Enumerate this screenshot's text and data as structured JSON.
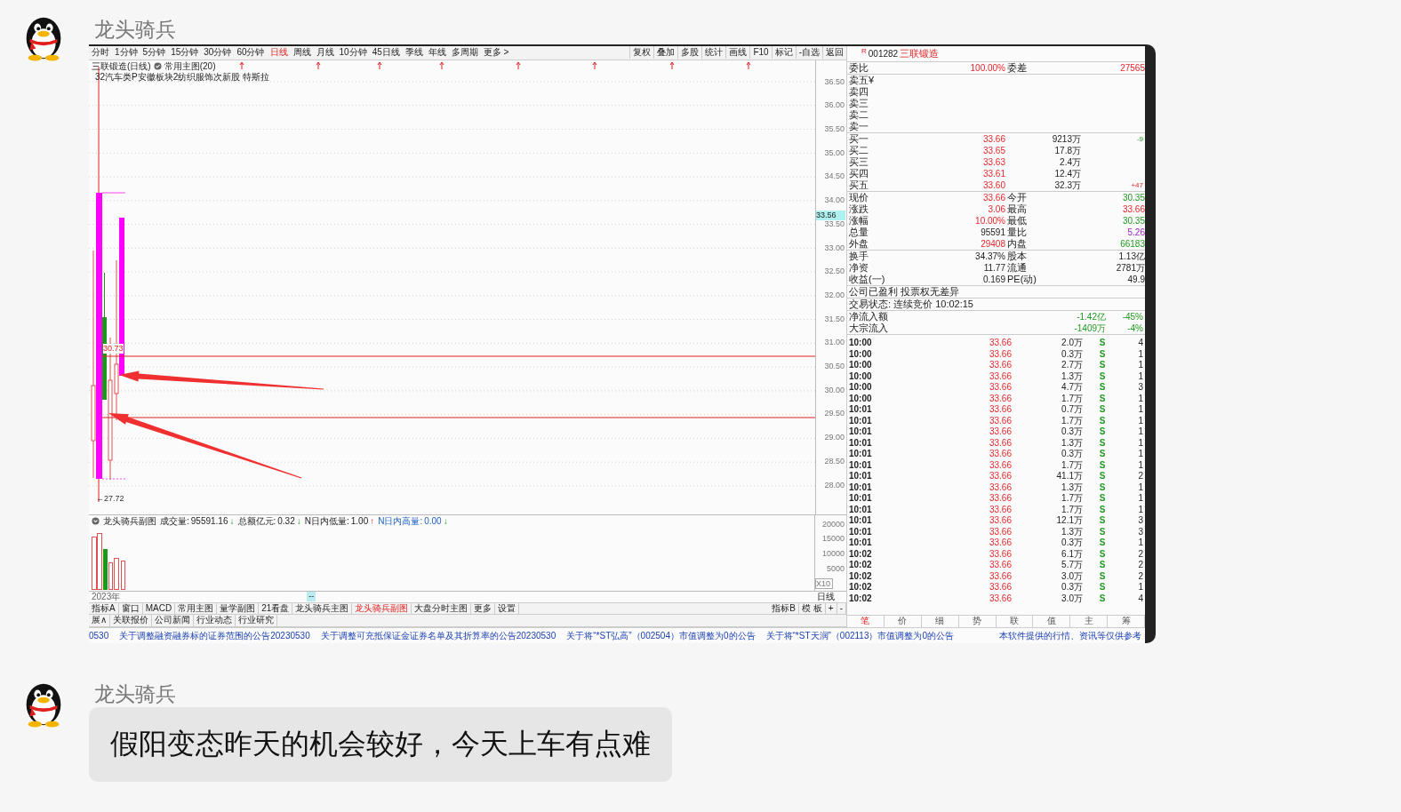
{
  "messages": [
    {
      "sender": "龙头骑兵",
      "kind": "screenshot",
      "screenshot": {
        "toolbar": {
          "periods": [
            {
              "label": "分时",
              "selected": false
            },
            {
              "label": "1分钟",
              "selected": false
            },
            {
              "label": "5分钟",
              "selected": false
            },
            {
              "label": "15分钟",
              "selected": false
            },
            {
              "label": "30分钟",
              "selected": false
            },
            {
              "label": "60分钟",
              "selected": false
            },
            {
              "label": "日线",
              "selected": true
            },
            {
              "label": "周线",
              "selected": false
            },
            {
              "label": "月线",
              "selected": false
            },
            {
              "label": "10分钟",
              "selected": false
            },
            {
              "label": "45日线",
              "selected": false
            },
            {
              "label": "季线",
              "selected": false
            },
            {
              "label": "年线",
              "selected": false
            },
            {
              "label": "多周期",
              "selected": false
            },
            {
              "label": "更多 >",
              "selected": false
            }
          ],
          "tools": [
            "复权",
            "叠加",
            "多股",
            "统计",
            "画线",
            "F10",
            "标记",
            "-自选",
            "返回"
          ]
        },
        "chart": {
          "title": "三联锻造(日线)",
          "template": "常用主图(20)",
          "concepts": "32汽车类P安徽板块2纺织服饰次新股 特斯拉",
          "price_labels": [
            "36.50",
            "36.00",
            "35.50",
            "35.00",
            "34.50",
            "34.00",
            "33.50",
            "33.00",
            "32.50",
            "32.00",
            "31.50",
            "31.00",
            "30.50",
            "30.00",
            "29.50",
            "29.00",
            "28.50",
            "28.00"
          ],
          "current_price": "33.56",
          "level_label": "30.73",
          "low_label": "←27.72"
        },
        "sub_chart": {
          "title": "龙头骑兵副图",
          "indicators": [
            {
              "label": "成交量:",
              "value": "95591.16",
              "arrow": "↓",
              "kind": "fall",
              "highlight": false
            },
            {
              "label": "总额亿元:",
              "value": "0.32",
              "arrow": "↓",
              "kind": "fall",
              "highlight": false
            },
            {
              "label": "N日内低量:",
              "value": "1.00",
              "arrow": "↑",
              "kind": "rise",
              "highlight": false
            },
            {
              "label": "N日内高量:",
              "value": "0.00",
              "arrow": "↓",
              "kind": "fall",
              "highlight": true
            }
          ],
          "axis_labels": [
            "20000",
            "15000",
            "10000",
            "5000"
          ],
          "scale": "X10"
        },
        "date_bar": {
          "year": "2023年",
          "marker": "--",
          "period": "日线"
        },
        "indicator_tabs": [
          {
            "label": "指标A",
            "selected": false
          },
          {
            "label": "窗口",
            "selected": false
          },
          {
            "label": "MACD",
            "selected": false
          },
          {
            "label": "常用主图",
            "selected": false
          },
          {
            "label": "量学副图",
            "selected": false
          },
          {
            "label": "21看盘",
            "selected": false
          },
          {
            "label": "龙头骑兵主图",
            "selected": false
          },
          {
            "label": "龙头骑兵副图",
            "selected": true
          },
          {
            "label": "大盘分时主图",
            "selected": false
          },
          {
            "label": "更多",
            "selected": false
          },
          {
            "label": "设置",
            "selected": false
          }
        ],
        "indicator_tools": [
          "指标B",
          "模 板",
          "+",
          "-"
        ],
        "info_tabs": [
          "展∧",
          "关联报价",
          "公司新闻",
          "行业动态",
          "行业研究"
        ],
        "news": [
          "0530",
          "关于调整融资融券标的证券范围的公告20230530",
          "关于调整可充抵保证金证券名单及其折算率的公告20230530",
          "关于将“*ST弘高”（002504）市值调整为0的公告",
          "关于将“*ST天润”（002113）市值调整为0的公告"
        ],
        "disclaimer": "本软件提供的行情、资讯等仅供参考",
        "quote": {
          "flag": "R",
          "code": "001282",
          "name": "三联锻造",
          "groups": [
            [
              {
                "kind": "pair",
                "cells": [
                  {
                    "label": "委比",
                    "value": "100.00%",
                    "kind": "rise"
                  },
                  {
                    "label": "委差",
                    "value": "27565",
                    "kind": "rise"
                  }
                ]
              }
            ],
            [
              {
                "kind": "level",
                "label": "卖五¥"
              },
              {
                "kind": "level",
                "label": "卖四"
              },
              {
                "kind": "level",
                "label": "卖三"
              },
              {
                "kind": "level",
                "label": "卖二"
              },
              {
                "kind": "level",
                "label": "卖一"
              }
            ],
            [
              {
                "kind": "level",
                "label": "买一",
                "price": "33.66",
                "volume": "9213万",
                "change": {
                  "text": "-9",
                  "kind": "fall"
                }
              },
              {
                "kind": "level",
                "label": "买二",
                "price": "33.65",
                "volume": "17.8万"
              },
              {
                "kind": "level",
                "label": "买三",
                "price": "33.63",
                "volume": "2.4万"
              },
              {
                "kind": "level",
                "label": "买四",
                "price": "33.61",
                "volume": "12.4万"
              },
              {
                "kind": "level",
                "label": "买五",
                "price": "33.60",
                "volume": "32.3万",
                "change": {
                  "text": "+47",
                  "kind": "rise"
                }
              }
            ],
            [
              {
                "kind": "pair",
                "cells": [
                  {
                    "label": "现价",
                    "value": "33.66",
                    "kind": "rise"
                  },
                  {
                    "label": "今开",
                    "value": "30.35",
                    "kind": "fall"
                  }
                ]
              },
              {
                "kind": "pair",
                "cells": [
                  {
                    "label": "涨跌",
                    "value": "3.06",
                    "kind": "rise"
                  },
                  {
                    "label": "最高",
                    "value": "33.66",
                    "kind": "rise"
                  }
                ]
              },
              {
                "kind": "pair",
                "cells": [
                  {
                    "label": "涨幅",
                    "value": "10.00%",
                    "kind": "rise"
                  },
                  {
                    "label": "最低",
                    "value": "30.35",
                    "kind": "fall"
                  }
                ]
              },
              {
                "kind": "pair",
                "cells": [
                  {
                    "label": "总量",
                    "value": "95591",
                    "kind": "flat"
                  },
                  {
                    "label": "量比",
                    "value": "5.26",
                    "kind": "ratio"
                  }
                ]
              },
              {
                "kind": "pair",
                "cells": [
                  {
                    "label": "外盘",
                    "value": "29408",
                    "kind": "rise"
                  },
                  {
                    "label": "内盘",
                    "value": "66183",
                    "kind": "fall"
                  }
                ]
              }
            ],
            [
              {
                "kind": "pair",
                "cells": [
                  {
                    "label": "换手",
                    "value": "34.37%",
                    "kind": "flat"
                  },
                  {
                    "label": "股本",
                    "value": "1.13亿",
                    "kind": "flat"
                  }
                ]
              },
              {
                "kind": "pair",
                "cells": [
                  {
                    "label": "净资",
                    "value": "11.77",
                    "kind": "flat"
                  },
                  {
                    "label": "流通",
                    "value": "2781万",
                    "kind": "flat"
                  }
                ]
              },
              {
                "kind": "pair",
                "cells": [
                  {
                    "label": "收益(一)",
                    "value": "0.169",
                    "kind": "flat"
                  },
                  {
                    "label": "PE(动)",
                    "value": "49.9",
                    "kind": "flat"
                  }
                ]
              }
            ],
            [
              {
                "kind": "note",
                "text": "公司已盈利 投票权无差异"
              }
            ],
            [
              {
                "kind": "note",
                "text": "交易状态: 连续竞价 10:02:15"
              }
            ],
            [
              {
                "kind": "flow",
                "label": "净流入额",
                "figures": [
                  {
                    "text": "-1.42亿",
                    "kind": "fall"
                  },
                  {
                    "text": "-45%",
                    "kind": "fall"
                  }
                ]
              },
              {
                "kind": "flow",
                "label": "大宗流入",
                "figures": [
                  {
                    "text": "-1409万",
                    "kind": "fall"
                  },
                  {
                    "text": "-4%",
                    "kind": "fall"
                  }
                ]
              }
            ]
          ]
        },
        "trades": [
          {
            "time": "10:00",
            "price": "33.66",
            "volume": "2.0万",
            "side": "S",
            "count": "4"
          },
          {
            "time": "10:00",
            "price": "33.66",
            "volume": "0.3万",
            "side": "S",
            "count": "1"
          },
          {
            "time": "10:00",
            "price": "33.66",
            "volume": "2.7万",
            "side": "S",
            "count": "1"
          },
          {
            "time": "10:00",
            "price": "33.66",
            "volume": "1.3万",
            "side": "S",
            "count": "1"
          },
          {
            "time": "10:00",
            "price": "33.66",
            "volume": "4.7万",
            "side": "S",
            "count": "3"
          },
          {
            "time": "10:00",
            "price": "33.66",
            "volume": "1.7万",
            "side": "S",
            "count": "1"
          },
          {
            "time": "10:01",
            "price": "33.66",
            "volume": "0.7万",
            "side": "S",
            "count": "1"
          },
          {
            "time": "10:01",
            "price": "33.66",
            "volume": "1.7万",
            "side": "S",
            "count": "1"
          },
          {
            "time": "10:01",
            "price": "33.66",
            "volume": "0.3万",
            "side": "S",
            "count": "1"
          },
          {
            "time": "10:01",
            "price": "33.66",
            "volume": "1.3万",
            "side": "S",
            "count": "1"
          },
          {
            "time": "10:01",
            "price": "33.66",
            "volume": "0.3万",
            "side": "S",
            "count": "1"
          },
          {
            "time": "10:01",
            "price": "33.66",
            "volume": "1.7万",
            "side": "S",
            "count": "1"
          },
          {
            "time": "10:01",
            "price": "33.66",
            "volume": "41.1万",
            "side": "S",
            "count": "2"
          },
          {
            "time": "10:01",
            "price": "33.66",
            "volume": "1.3万",
            "side": "S",
            "count": "1"
          },
          {
            "time": "10:01",
            "price": "33.66",
            "volume": "1.7万",
            "side": "S",
            "count": "1"
          },
          {
            "time": "10:01",
            "price": "33.66",
            "volume": "1.7万",
            "side": "S",
            "count": "1"
          },
          {
            "time": "10:01",
            "price": "33.66",
            "volume": "12.1万",
            "side": "S",
            "count": "3"
          },
          {
            "time": "10:01",
            "price": "33.66",
            "volume": "1.3万",
            "side": "S",
            "count": "3"
          },
          {
            "time": "10:01",
            "price": "33.66",
            "volume": "0.3万",
            "side": "S",
            "count": "1"
          },
          {
            "time": "10:02",
            "price": "33.66",
            "volume": "6.1万",
            "side": "S",
            "count": "2"
          },
          {
            "time": "10:02",
            "price": "33.66",
            "volume": "5.7万",
            "side": "S",
            "count": "2"
          },
          {
            "time": "10:02",
            "price": "33.66",
            "volume": "3.0万",
            "side": "S",
            "count": "2"
          },
          {
            "time": "10:02",
            "price": "33.66",
            "volume": "0.3万",
            "side": "S",
            "count": "1"
          },
          {
            "time": "10:02",
            "price": "33.66",
            "volume": "3.0万",
            "side": "S",
            "count": "4"
          }
        ],
        "trade_tabs": [
          {
            "label": "笔",
            "selected": true
          },
          {
            "label": "价",
            "selected": false
          },
          {
            "label": "细",
            "selected": false
          },
          {
            "label": "势",
            "selected": false
          },
          {
            "label": "联",
            "selected": false
          },
          {
            "label": "值",
            "selected": false
          },
          {
            "label": "主",
            "selected": false
          },
          {
            "label": "筹",
            "selected": false
          }
        ]
      }
    },
    {
      "sender": "龙头骑兵",
      "kind": "text",
      "text": "假阳变态昨天的机会较好，今天上车有点难"
    }
  ]
}
